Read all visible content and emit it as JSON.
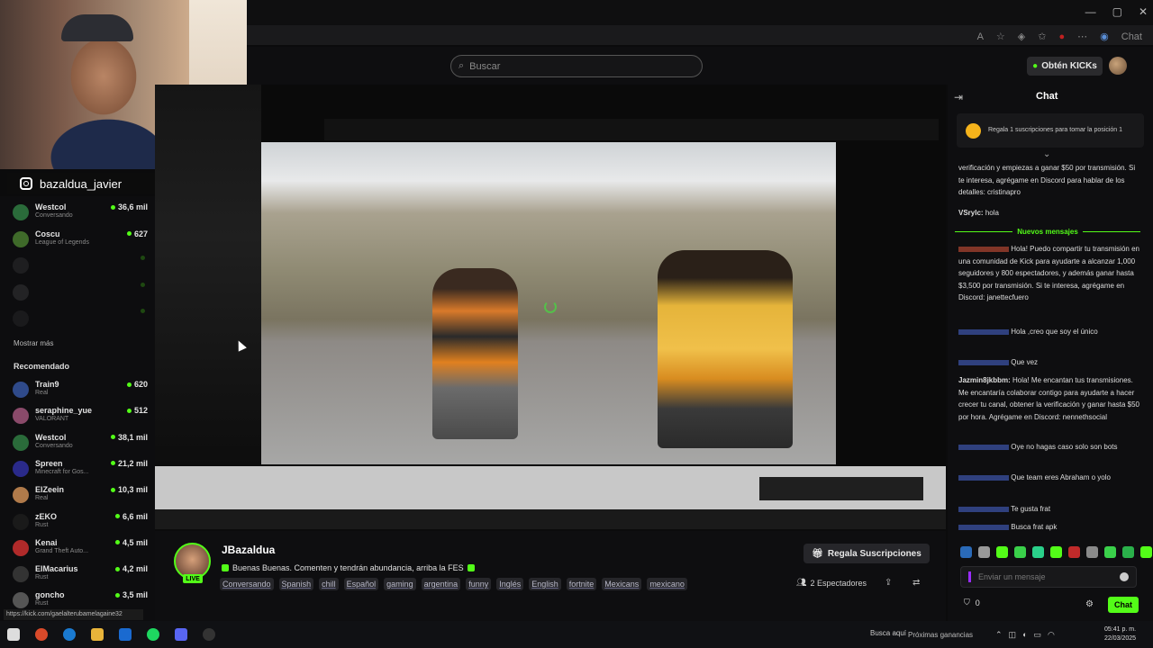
{
  "header": {
    "search_placeholder": "Buscar",
    "get_kicks_label": "Obtén KICKs",
    "browser_chat_label": "Chat"
  },
  "overlay": {
    "instagram_handle": "bazaldua_javier"
  },
  "sidebar": {
    "following": [
      {
        "name": "Westcol",
        "game": "Conversando",
        "viewers": "36,6 mil",
        "color": "#2a6b3a"
      },
      {
        "name": "Coscu",
        "game": "League of Legends",
        "viewers": "627",
        "color": "#3f6a2a"
      },
      {
        "name": "",
        "game": "",
        "viewers": "",
        "color": "#555"
      },
      {
        "name": "",
        "game": "",
        "viewers": "",
        "color": "#666"
      },
      {
        "name": "",
        "game": "",
        "viewers": "",
        "color": "#444"
      }
    ],
    "show_more_label": "Mostrar más",
    "recommended_title": "Recomendado",
    "recommended": [
      {
        "name": "Train9",
        "game": "Real",
        "viewers": "620",
        "color": "#2f4a8a"
      },
      {
        "name": "seraphine_yue",
        "game": "VALORANT",
        "viewers": "512",
        "color": "#8a4a6a"
      },
      {
        "name": "Westcol",
        "game": "Conversando",
        "viewers": "38,1 mil",
        "color": "#2a6b3a"
      },
      {
        "name": "Spreen",
        "game": "Minecraft for Gos...",
        "viewers": "21,2 mil",
        "color": "#2a2a8a"
      },
      {
        "name": "ElZeein",
        "game": "Real",
        "viewers": "10,3 mil",
        "color": "#b07a4a"
      },
      {
        "name": "zEKO",
        "game": "Rust",
        "viewers": "6,6 mil",
        "color": "#1a1a1a"
      },
      {
        "name": "Kenai",
        "game": "Grand Theft Auto...",
        "viewers": "4,5 mil",
        "color": "#b02a2a"
      },
      {
        "name": "ElMacarius",
        "game": "Rust",
        "viewers": "4,2 mil",
        "color": "#333"
      },
      {
        "name": "goncho",
        "game": "Rust",
        "viewers": "3,5 mil",
        "color": "#555"
      }
    ]
  },
  "stream": {
    "streamer_name": "JBazaldua",
    "live_badge": "LIVE",
    "title": "Buenas Buenas. Comenten y tendrán abundancia, arriba la FES",
    "tags": [
      "Conversando",
      "Spanish",
      "chill",
      "Español",
      "gaming",
      "argentina",
      "funny",
      "Inglés",
      "English",
      "fortnite",
      "Mexicans",
      "mexicano"
    ],
    "gift_label": "Regala Suscripciones",
    "viewers_label": "2 Espectadores"
  },
  "chat": {
    "title": "Chat",
    "pinned_text": "Regala 1 suscripciones para tomar la posición 1",
    "new_messages_label": "Nuevos mensajes",
    "messages": [
      {
        "user": "",
        "text": "verificación y empiezas a ganar $50 por transmisión. Si te interesa, agrégame en Discord para hablar de los detalles: cristinapro",
        "color": "#dedede"
      },
      {
        "user": "VSrylc:",
        "text": "hola",
        "color": "#dedede"
      },
      {
        "user": "",
        "text": "Hola! Puedo compartir tu transmisión en una comunidad de Kick para ayudarte a alcanzar 1,000 seguidores y 800 espectadores, y además ganar hasta $3,500 por transmisión. Si te interesa, agrégame en Discord: janettecfuero",
        "color": "#e0563a"
      },
      {
        "user": "",
        "text": "Hola ,creo que soy el único",
        "color": "#4a6ad8"
      },
      {
        "user": "",
        "text": "Que vez",
        "color": "#4a6ad8"
      },
      {
        "user": "Jazmin8jkbbm:",
        "text": "Hola! Me encantan tus transmisiones. Me encantaría colaborar contigo para ayudarte a hacer crecer tu canal, obtener la verificación y ganar hasta $50 por hora. Agrégame en Discord: nennethsocial",
        "color": "#dedede"
      },
      {
        "user": "",
        "text": "Oye no hagas caso solo son bots",
        "color": "#4a6ad8"
      },
      {
        "user": "",
        "text": "Que team eres Abraham o yolo",
        "color": "#4a6ad8"
      },
      {
        "user": "",
        "text": "Te gusta frat",
        "color": "#4a6ad8"
      },
      {
        "user": "",
        "text": "Busca frat apk",
        "color": "#4a6ad8"
      }
    ],
    "input_placeholder": "Enviar un mensaje",
    "points": "0",
    "send_label": "Chat"
  },
  "status_url": "https://kick.com/gaelalterubamelagaine32",
  "taskbar": {
    "search_label": "Busca aquí",
    "news_label": "Próximas ganancias",
    "time": "05:41 p. m.",
    "date": "22/03/2025"
  }
}
